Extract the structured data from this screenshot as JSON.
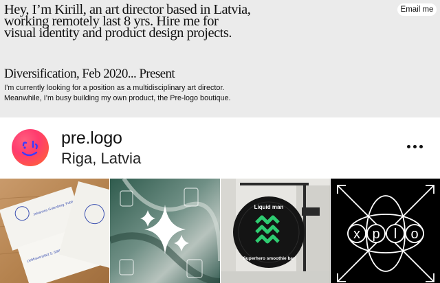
{
  "intro": {
    "text": "Hey, I’m Kirill, an art director based in Latvia, working remotely last 8 yrs. Hire me for visual identity and product design projects."
  },
  "email_button": {
    "label": "Email me"
  },
  "section": {
    "title": "Diversification, Feb 2020... Present",
    "body": "I’m currently looking for a position as a multidisciplinary art director. Meanwhile, I’m busy building my own product, the Pre-logo boutique."
  },
  "profile": {
    "name": "pre.logo",
    "location": "Riga, Latvia",
    "avatar_icon": "smiley-face-icon",
    "menu_icon": "more-horizontal-icon"
  },
  "grid": {
    "tiles": [
      {
        "subject": "business-cards",
        "card_text_1": "Johannes Gutenberg, Publisher",
        "card_text_2": "Liebfrauenplatz 5, 5500 Mainz"
      },
      {
        "subject": "abstract-sea-aerial"
      },
      {
        "subject": "hanging-shop-sign",
        "sign_top": "Liquid man",
        "sign_bottom": "Superhero smoothie bar"
      },
      {
        "subject": "xplo-logo",
        "letters": [
          "x",
          "p",
          "l",
          "o"
        ]
      }
    ]
  },
  "colors": {
    "top_bg": "#ebebeb",
    "avatar_pink": "#ff3b6e",
    "avatar_orange": "#ff6a2a",
    "avatar_stroke": "#3b3bff",
    "sign_green": "#2ecc71",
    "xplo_bg": "#000000"
  }
}
